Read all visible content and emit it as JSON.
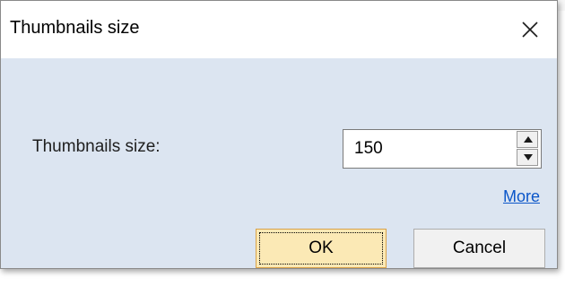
{
  "dialog": {
    "title": "Thumbnails size",
    "close_icon": "close-icon",
    "label": "Thumbnails size:",
    "spinner_value": "150",
    "spinner_up_icon": "triangle-up-icon",
    "spinner_down_icon": "triangle-down-icon",
    "more_link": "More",
    "ok_label": "OK",
    "cancel_label": "Cancel"
  },
  "colors": {
    "client_background": "#dce5f1",
    "ok_button_background": "#fbe9b5",
    "link": "#0b56c9"
  }
}
